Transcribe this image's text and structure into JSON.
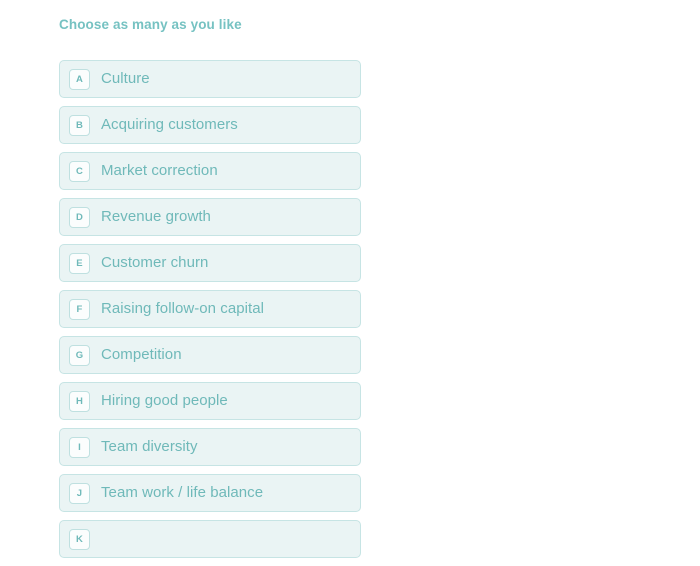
{
  "page": {
    "background_color": "#ffffff",
    "accent_color": "#6fb9b9",
    "fill_color": "#eaf4f4",
    "border_color": "#c6e4e4"
  },
  "instruction": "Choose as many as you like",
  "options": [
    {
      "key": "A",
      "label": "Culture"
    },
    {
      "key": "B",
      "label": "Acquiring customers"
    },
    {
      "key": "C",
      "label": "Market correction"
    },
    {
      "key": "D",
      "label": "Revenue growth"
    },
    {
      "key": "E",
      "label": "Customer churn"
    },
    {
      "key": "F",
      "label": "Raising follow-on capital"
    },
    {
      "key": "G",
      "label": "Competition"
    },
    {
      "key": "H",
      "label": "Hiring good people"
    },
    {
      "key": "I",
      "label": "Team diversity"
    },
    {
      "key": "J",
      "label": "Team work / life balance"
    },
    {
      "key": "K",
      "label": ""
    }
  ]
}
